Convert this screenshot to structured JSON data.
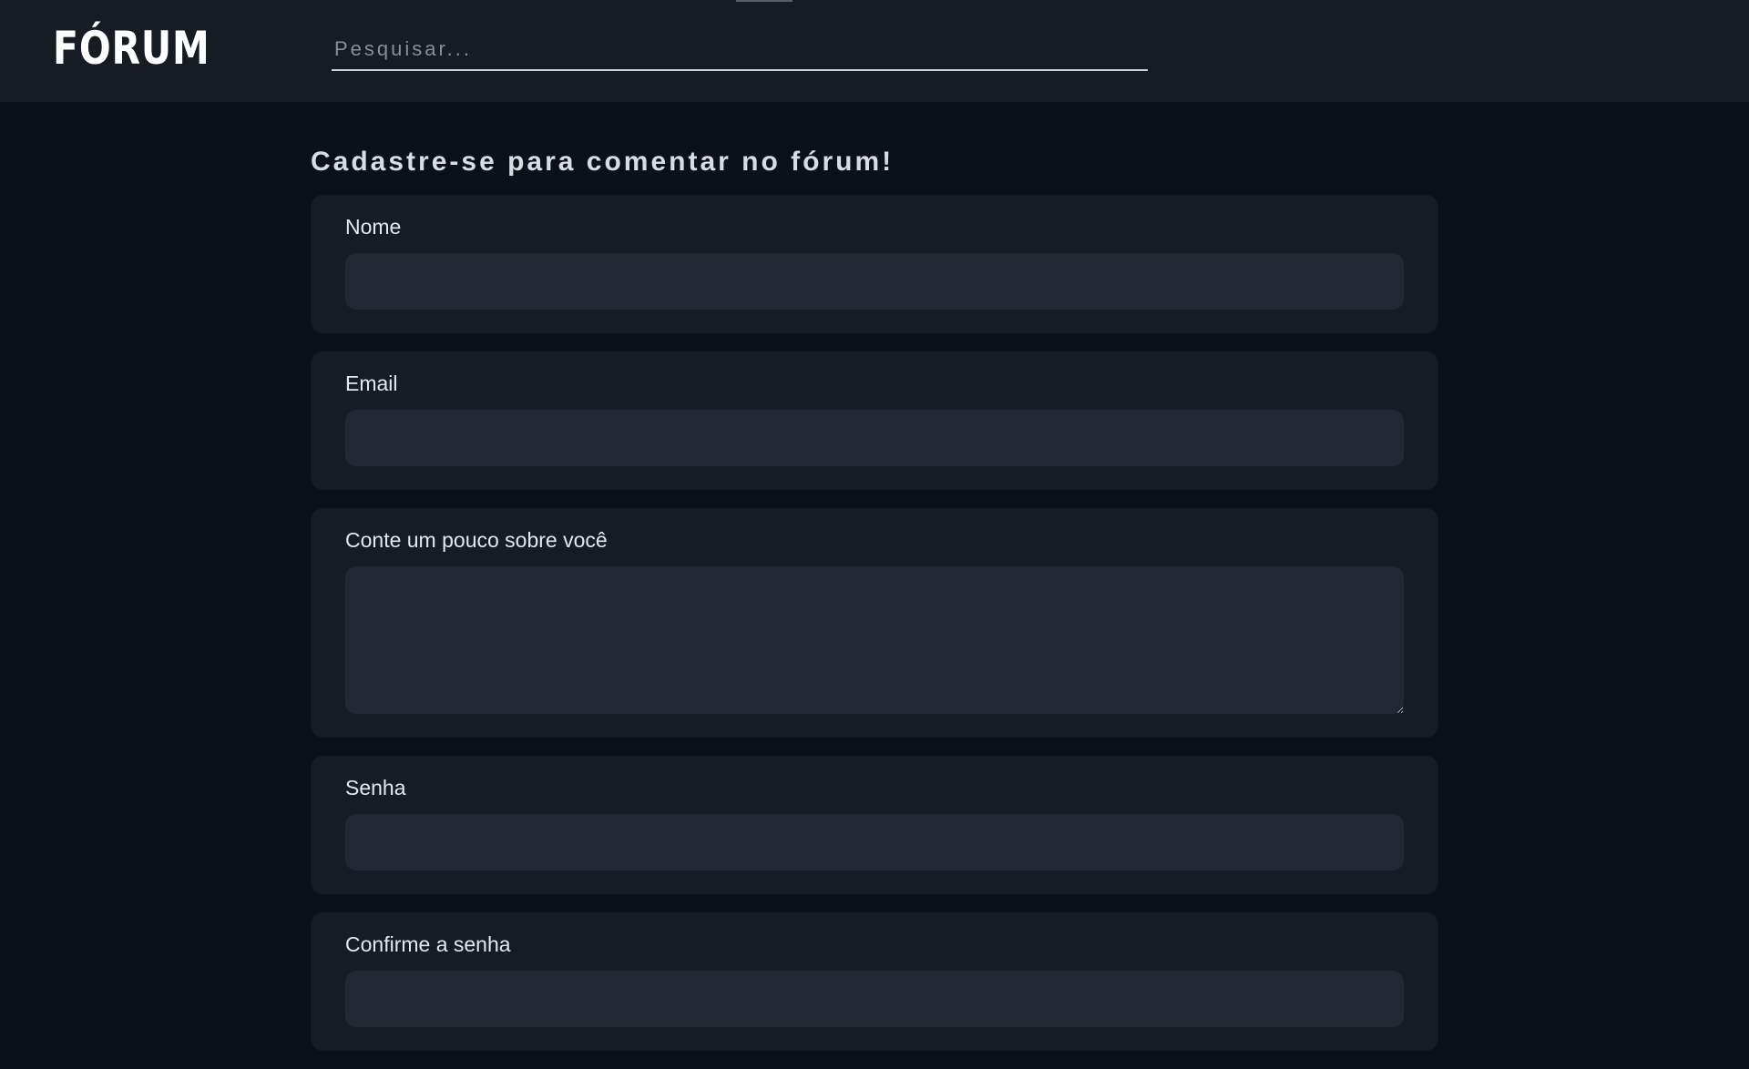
{
  "header": {
    "logo": "FÓRUM",
    "search": {
      "placeholder": "Pesquisar...",
      "value": ""
    }
  },
  "form": {
    "title": "Cadastre-se para comentar no fórum!",
    "fields": [
      {
        "label": "Nome",
        "value": ""
      },
      {
        "label": "Email",
        "value": ""
      },
      {
        "label": "Conte um pouco sobre você",
        "value": ""
      },
      {
        "label": "Senha",
        "value": ""
      },
      {
        "label": "Confirme a senha",
        "value": ""
      }
    ]
  },
  "colors": {
    "page_background": "#0c1018",
    "header_background": "#171c24",
    "card_background": "#171c24",
    "input_background": "#212831",
    "text": "#e4e7eb"
  }
}
